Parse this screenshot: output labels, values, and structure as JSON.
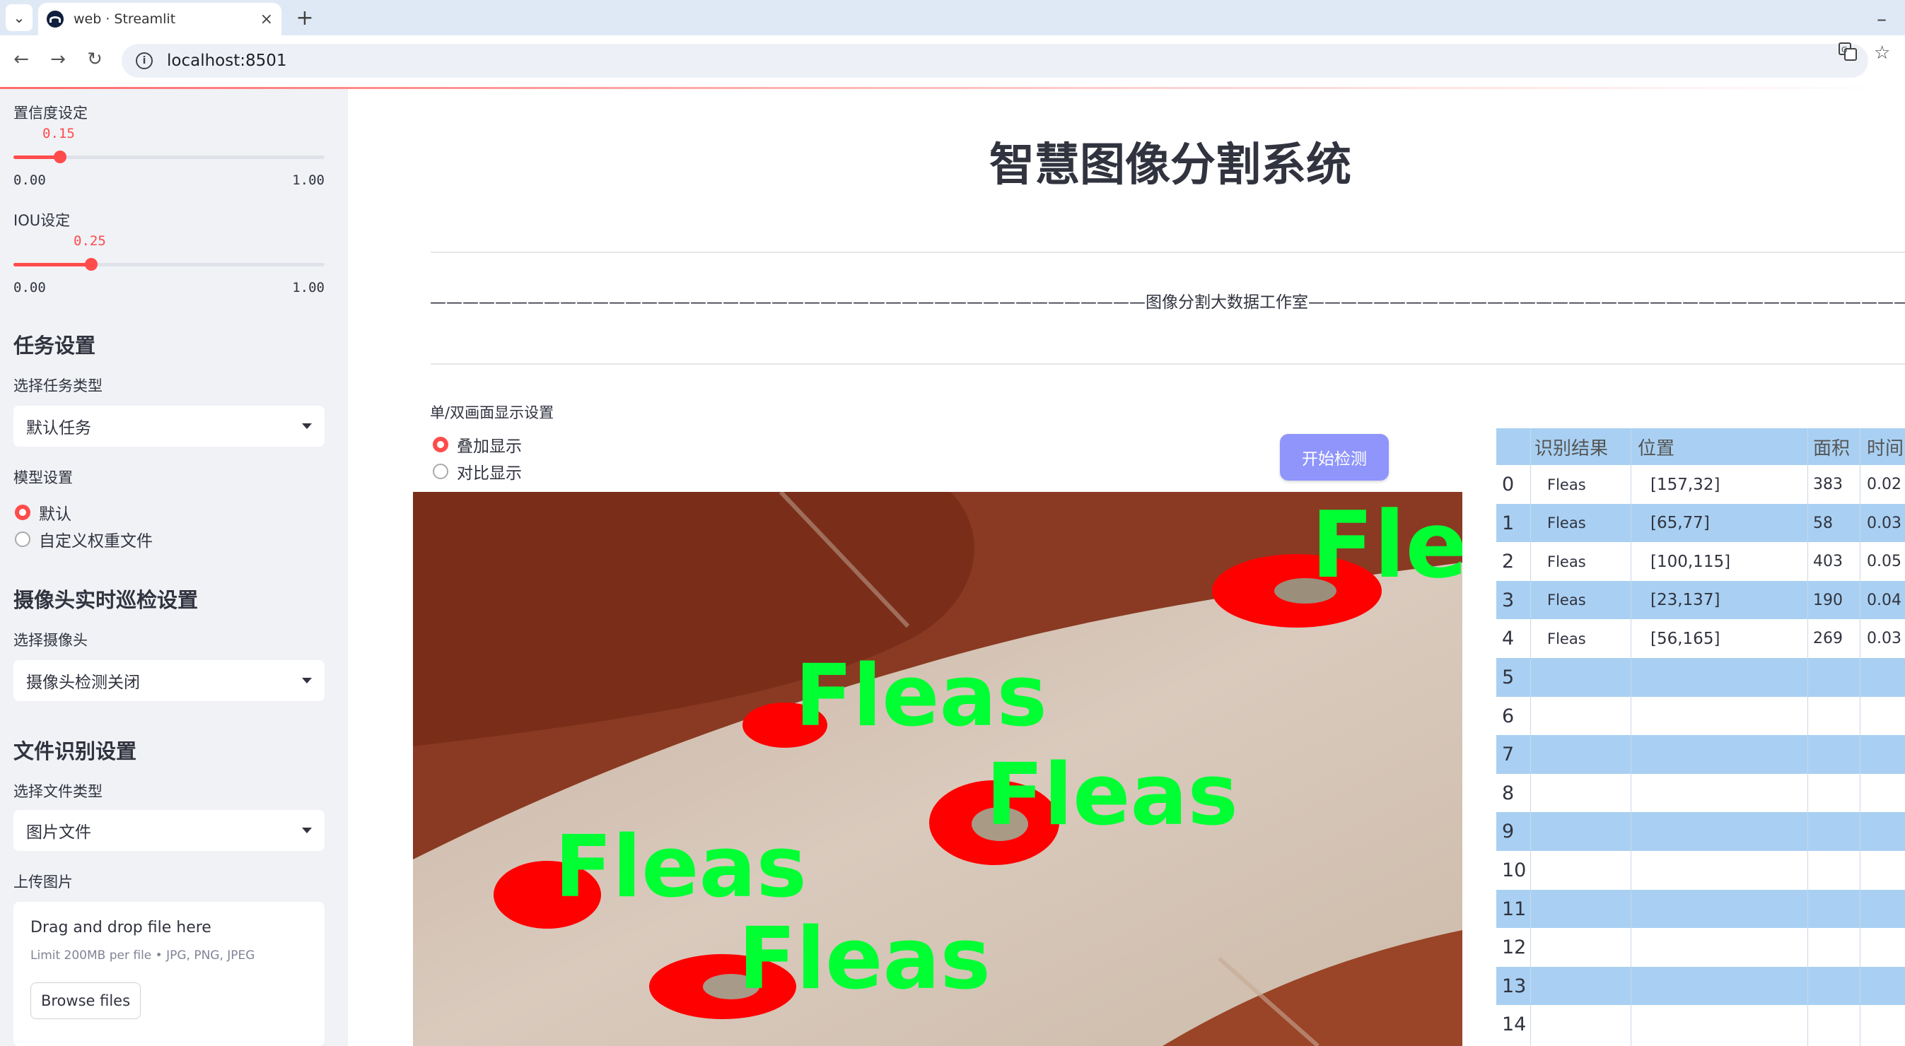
{
  "browser": {
    "tab_title": "web · Streamlit",
    "url": "localhost:8501",
    "close_glyph": "×",
    "newtab_glyph": "+"
  },
  "sidebar": {
    "confidence": {
      "label": "置信度设定",
      "value": 0.15,
      "value_text": "0.15",
      "min": "0.00",
      "max": "1.00"
    },
    "iou": {
      "label": "IOU设定",
      "value": 0.25,
      "value_text": "0.25",
      "min": "0.00",
      "max": "1.00"
    },
    "task_heading": "任务设置",
    "task_type_label": "选择任务类型",
    "task_type_value": "默认任务",
    "model_label": "模型设置",
    "model_options": [
      {
        "label": "默认",
        "selected": true
      },
      {
        "label": "自定义权重文件",
        "selected": false
      }
    ],
    "camera_heading": "摄像头实时巡检设置",
    "camera_label": "选择摄像头",
    "camera_value": "摄像头检测关闭",
    "file_heading": "文件识别设置",
    "file_type_label": "选择文件类型",
    "file_type_value": "图片文件",
    "upload_label": "上传图片",
    "uploader": {
      "title": "Drag and drop file here",
      "subtitle": "Limit 200MB per file • JPG, PNG, JPEG",
      "button": "Browse files"
    }
  },
  "main": {
    "title": "智慧图像分割系统",
    "subtitle": "————————————————————————————————————————————图像分割大数据工作室————————————————————————————————————————————",
    "display_label": "单/双画面显示设置",
    "display_options": [
      {
        "label": "叠加显示",
        "selected": true
      },
      {
        "label": "对比显示",
        "selected": false
      }
    ],
    "detect_button": "开始检测",
    "image_labels": [
      "Fle",
      "Fleas",
      "Fleas",
      "Fleas",
      "Fleas"
    ]
  },
  "table": {
    "headers": [
      "",
      "识别结果",
      "位置",
      "面积",
      "时间"
    ],
    "rows": [
      {
        "idx": "0",
        "result": "Fleas",
        "pos": "[157,32]",
        "area": "383",
        "time": "0.02"
      },
      {
        "idx": "1",
        "result": "Fleas",
        "pos": "[65,77]",
        "area": "58",
        "time": "0.03"
      },
      {
        "idx": "2",
        "result": "Fleas",
        "pos": "[100,115]",
        "area": "403",
        "time": "0.05"
      },
      {
        "idx": "3",
        "result": "Fleas",
        "pos": "[23,137]",
        "area": "190",
        "time": "0.04"
      },
      {
        "idx": "4",
        "result": "Fleas",
        "pos": "[56,165]",
        "area": "269",
        "time": "0.03"
      },
      {
        "idx": "5",
        "result": "",
        "pos": "",
        "area": "",
        "time": ""
      },
      {
        "idx": "6",
        "result": "",
        "pos": "",
        "area": "",
        "time": ""
      },
      {
        "idx": "7",
        "result": "",
        "pos": "",
        "area": "",
        "time": ""
      },
      {
        "idx": "8",
        "result": "",
        "pos": "",
        "area": "",
        "time": ""
      },
      {
        "idx": "9",
        "result": "",
        "pos": "",
        "area": "",
        "time": ""
      },
      {
        "idx": "10",
        "result": "",
        "pos": "",
        "area": "",
        "time": ""
      },
      {
        "idx": "11",
        "result": "",
        "pos": "",
        "area": "",
        "time": ""
      },
      {
        "idx": "12",
        "result": "",
        "pos": "",
        "area": "",
        "time": ""
      },
      {
        "idx": "13",
        "result": "",
        "pos": "",
        "area": "",
        "time": ""
      },
      {
        "idx": "14",
        "result": "",
        "pos": "",
        "area": "",
        "time": ""
      }
    ]
  },
  "colors": {
    "accent": "#ff4b4b",
    "sidebar_bg": "#f0f2f6",
    "table_band": "#a9d0f2",
    "detect_button": "#8f95fb",
    "mask_red": "#ff0000",
    "label_green": "#00ff33"
  }
}
